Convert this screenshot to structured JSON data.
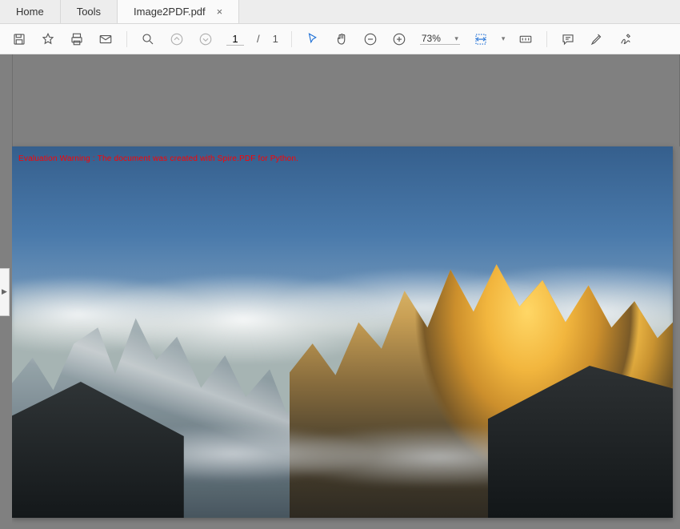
{
  "tabs": {
    "home": "Home",
    "tools": "Tools",
    "active": {
      "label": "Image2PDF.pdf",
      "close": "×"
    }
  },
  "toolbar": {
    "page": {
      "current": "1",
      "sep": "/",
      "total": "1"
    },
    "zoom": {
      "value": "73%"
    }
  },
  "document": {
    "watermark": "Evaluation Warning : The document was created with Spire.PDF for Python."
  },
  "sidebar": {
    "handle": "▶"
  }
}
